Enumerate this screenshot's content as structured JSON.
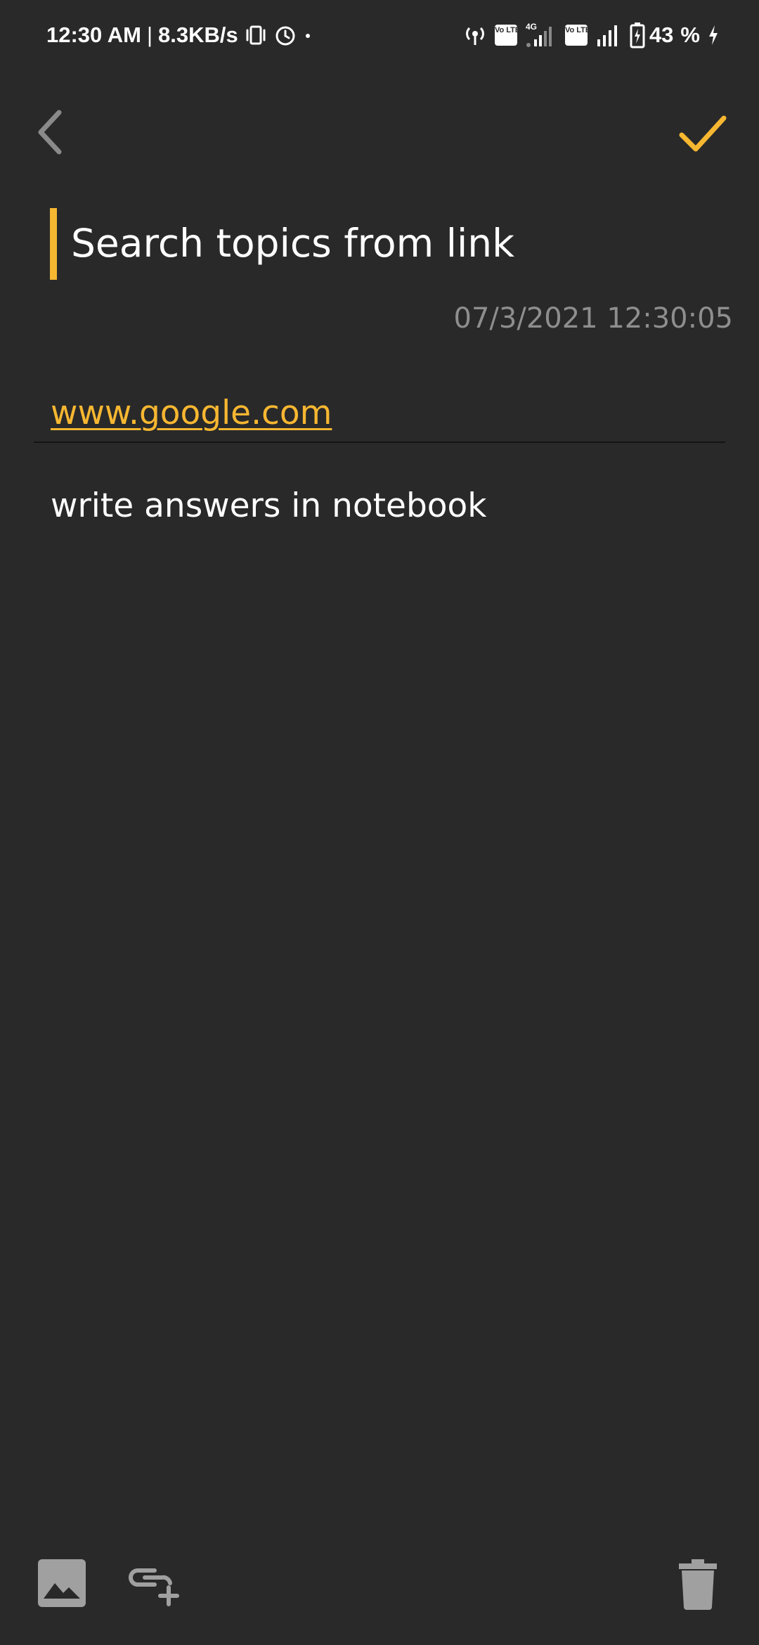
{
  "status_bar": {
    "time": "12:30 AM",
    "separator": "|",
    "net_speed": "8.3KB/s",
    "network_type": "4G",
    "volte_label": "Vo LTE",
    "battery_percent": "43",
    "percent_sign": "%"
  },
  "top_bar": {
    "back_icon": "chevron-left-icon",
    "save_icon": "check-icon",
    "accent_color": "#f7b731"
  },
  "note": {
    "title": "Search topics from link",
    "datetime": "07/3/2021 12:30:05",
    "link": "www.google.com",
    "body": "write answers in notebook"
  },
  "bottom_bar": {
    "icons": [
      "image-icon",
      "add-link-icon",
      "trash-icon"
    ],
    "icon_color": "#a0a0a0"
  },
  "colors": {
    "background": "#292929",
    "accent": "#f7b731",
    "muted_text": "#8e8e8e"
  }
}
